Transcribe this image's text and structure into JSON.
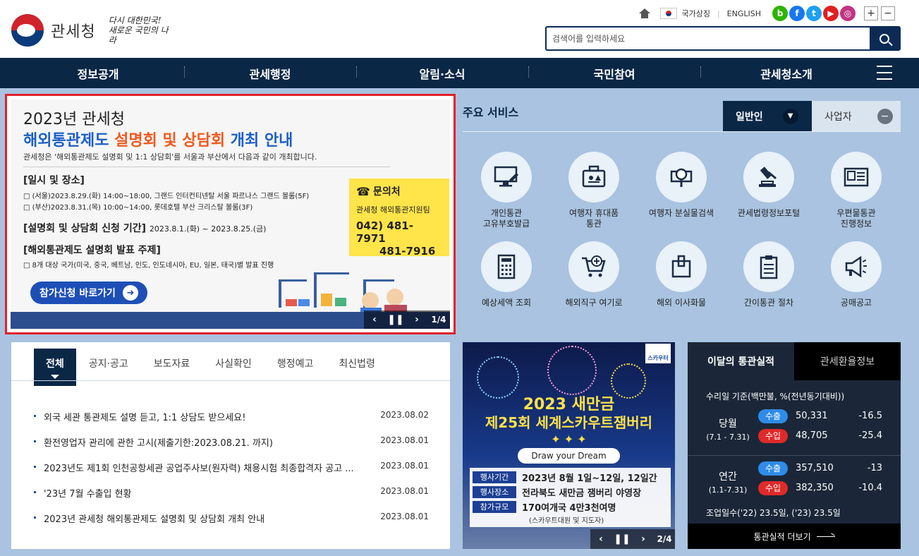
{
  "header": {
    "logo_name": "관세청",
    "slogan_line1": "다시 대한민국!",
    "slogan_line2": "새로운 국민의 나라",
    "util": {
      "national_symbol": "국가상징",
      "english": "ENGLISH",
      "zoom_in": "+",
      "zoom_out": "−"
    },
    "sns": [
      {
        "label": "b",
        "color": "#2db400"
      },
      {
        "label": "f",
        "color": "#1877f2"
      },
      {
        "label": "t",
        "color": "#1da1f2"
      },
      {
        "label": "▶",
        "color": "#e02020"
      },
      {
        "label": "◎",
        "color": "#c13584"
      }
    ],
    "search_placeholder": "검색어를 입력하세요"
  },
  "nav": {
    "items": [
      "정보공개",
      "관세행정",
      "알림·소식",
      "국민참여",
      "관세청소개"
    ]
  },
  "banner": {
    "year_line": "2023년 관세청",
    "title_part1": "해외통관제도 ",
    "title_part2": "설명회 및 상담회",
    "title_part3": " 개최 안내",
    "desc": "관세청은 '해외통관제도 설명회 및 1:1 상담회'를 서울과 부산에서 다음과 같이 개최합니다.",
    "h1": "[일시 및 장소]",
    "line1": "□ (서울)2023.8.29.(화) 14:00~18:00, 그랜드 인터컨티넨탈 서울 파르나스 그랜드 볼룸(5F)",
    "line2": "□ (부산)2023.8.31.(목) 10:00~14:00, 롯데호텔 부산 크리스탈 볼룸(3F)",
    "h2": "[설명회 및 상담회 신청 기간]",
    "h2_period": "2023.8.1.(화) ~ 2023.8.25.(금)",
    "h3": "[해외통관제도 설명회 발표 주제]",
    "line3": "□ 8개 대상 국가(미국, 중국, 베트남, 인도, 인도네시아, EU, 일본, 태국)별 발표 진행",
    "apply_label": "참가신청 바로가기",
    "contact_title": "문의처",
    "contact_org": "관세청 해외통관지원팀",
    "contact_num1": "042) 481-7971",
    "contact_num2": "481-7916",
    "counter": "1/4"
  },
  "services": {
    "title": "주요 서비스",
    "tab_general": "일반인",
    "tab_business": "사업자",
    "items": [
      {
        "line1": "개인통관",
        "line2": "고유부호발급"
      },
      {
        "line1": "여행자 휴대품",
        "line2": "통관"
      },
      {
        "line1": "여행자 분실물검색",
        "line2": ""
      },
      {
        "line1": "관세법령정보포털",
        "line2": ""
      },
      {
        "line1": "우편물통관",
        "line2": "진행정보"
      },
      {
        "line1": "예상세액 조회",
        "line2": ""
      },
      {
        "line1": "해외직구 여기로",
        "line2": ""
      },
      {
        "line1": "해외 이사화물",
        "line2": ""
      },
      {
        "line1": "간이통관 절차",
        "line2": ""
      },
      {
        "line1": "공매공고",
        "line2": ""
      }
    ]
  },
  "news": {
    "tabs": [
      "전체",
      "공지·공고",
      "보도자료",
      "사실확인",
      "행정예고",
      "최신법령"
    ],
    "rows": [
      {
        "title": "외국 세관 통관제도 설명 듣고, 1:1 상담도 받으세요!",
        "date": "2023.08.02"
      },
      {
        "title": "환전영업자 관리에 관한 고시(제출기한:2023.08.21. 까지)",
        "date": "2023.08.01"
      },
      {
        "title": "2023년도 제1회 인천공항세관 공업주사보(원자력) 채용시험 최종합격자 공고 ...",
        "date": "2023.08.01"
      },
      {
        "title": "'23년 7월 수출입 현황",
        "date": "2023.08.01"
      },
      {
        "title": "2023년 관세청 해외통관제도 설명회 및 상담회 개최 안내",
        "date": "2023.08.01"
      }
    ]
  },
  "promo": {
    "badge": "스카우터",
    "year": "2023 새만금",
    "title": "제25회 세계스카우트잼버리",
    "dream": "Draw your Dream",
    "rows": [
      {
        "label": "행사기간",
        "value": "2023년 8월 1일~12일, 12일간"
      },
      {
        "label": "행사장소",
        "value": "전라북도 새만금 잼버리 야영장"
      },
      {
        "label": "참가규모",
        "value": "170여개국 4만3천여명"
      }
    ],
    "sub": "(스카우트대원 및 지도자)",
    "counter": "2/4"
  },
  "stats": {
    "tab_active": "이달의 통관실적",
    "tab_inactive": "관세환율정보",
    "basis": "수리일 기준(백만불, %(전년동기대비))",
    "monthly": {
      "label": "당월",
      "range": "(7.1 - 7.31)",
      "export_label": "수출",
      "export_value": "50,331",
      "export_rate": "-16.5",
      "import_label": "수입",
      "import_value": "48,705",
      "import_rate": "-25.4"
    },
    "yearly": {
      "label": "연간",
      "range": "(1.1-7.31)",
      "export_label": "수출",
      "export_value": "357,510",
      "export_rate": "-13",
      "import_label": "수입",
      "import_value": "382,350",
      "import_rate": "-10.4"
    },
    "days": "조업일수('22) 23.5일, ('23) 23.5일",
    "more": "통관실적 더보기"
  }
}
